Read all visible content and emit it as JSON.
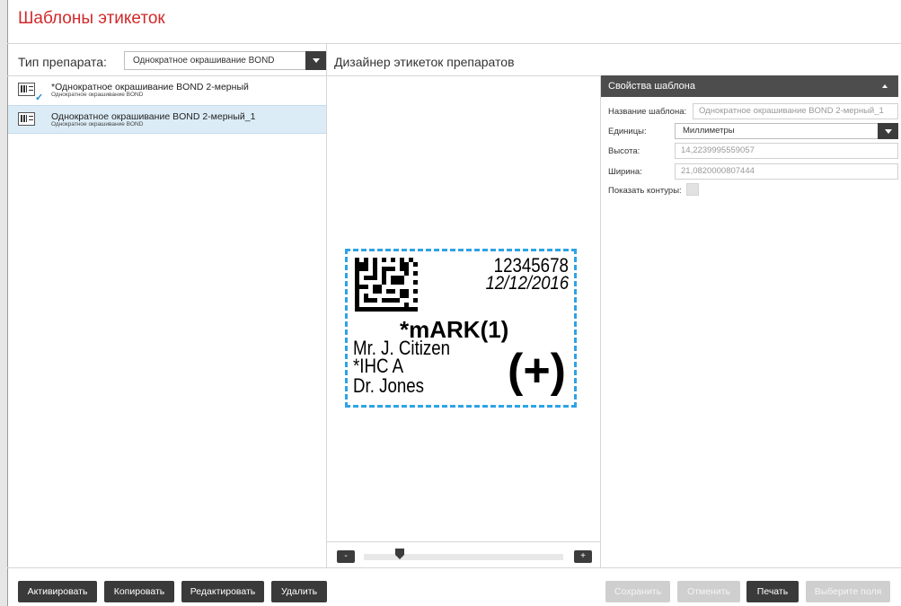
{
  "app": {
    "title": "Шаблоны этикеток"
  },
  "type_filter": {
    "label": "Тип препарата:",
    "value": "Однократное окрашивание BOND"
  },
  "templates": [
    {
      "name": "*Однократное окрашивание BOND 2-мерный",
      "subtitle": "Однократное окрашивание BOND",
      "active": true,
      "selected": false
    },
    {
      "name": "Однократное окрашивание BOND 2-мерный_1",
      "subtitle": "Однократное окрашивание BOND",
      "active": false,
      "selected": true
    }
  ],
  "designer": {
    "title": "Дизайнер этикеток препаратов",
    "label": {
      "number": "12345678",
      "date": "12/12/2016",
      "marker": "*mARK(1)",
      "patient": "Mr. J. Citizen",
      "test": "*IHC A",
      "doctor": "Dr. Jones",
      "result": "(+)"
    },
    "zoom": {
      "minus": "-",
      "plus": "+",
      "level": 0.17
    }
  },
  "properties": {
    "header": "Свойства шаблона",
    "name_label": "Название шаблона:",
    "name_value": "Однократное окрашивание BOND 2-мерный_1",
    "units_label": "Единицы:",
    "units_value": "Миллиметры",
    "height_label": "Высота:",
    "height_value": "14,2239995559057",
    "width_label": "Ширина:",
    "width_value": "21,0820000807444",
    "outline_label": "Показать контуры:",
    "outline_checked": false
  },
  "actions": {
    "activate": "Активировать",
    "copy": "Копировать",
    "edit": "Редактировать",
    "delete": "Удалить",
    "save": "Сохранить",
    "cancel": "Отменить",
    "print": "Печать",
    "select_fields": "Выберите поля"
  },
  "colors": {
    "title": "#d22a2a",
    "accent": "#2ea3e6",
    "selection": "#dcecf7",
    "button": "#3a3a3a",
    "disabled": "#cfcfcf"
  }
}
